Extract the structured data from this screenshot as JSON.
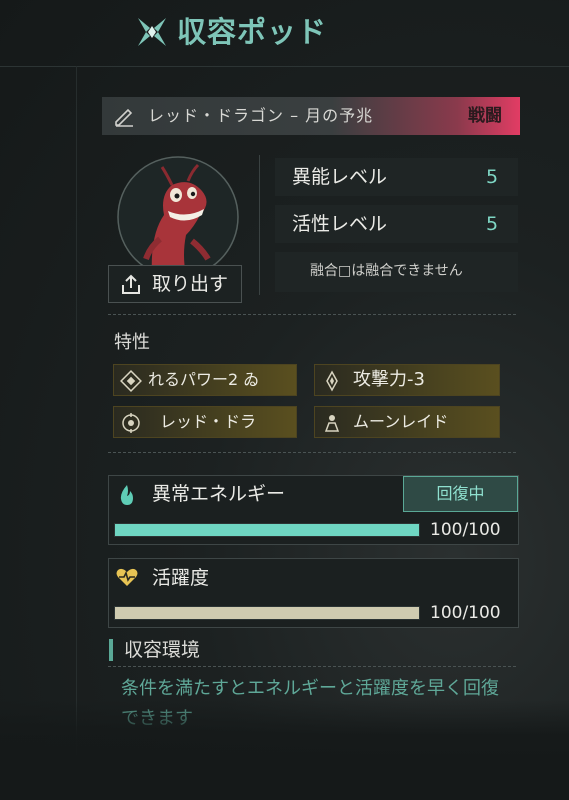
{
  "header": {
    "title": "収容ポッド",
    "icon": "x-emblem-icon"
  },
  "creature": {
    "name": "レッド・ドラゴン – 月の予兆",
    "tag": "戦闘",
    "extract_label": "取り出す"
  },
  "stats": [
    {
      "label": "異能レベル",
      "value": "5"
    },
    {
      "label": "活性レベル",
      "value": "5"
    }
  ],
  "fusion_note": "融合□は融合できません",
  "traits": {
    "title": "特性",
    "items": [
      {
        "icon": "diamond-icon",
        "label": "れるパワー2 ゐ"
      },
      {
        "icon": "crystal-icon",
        "label": "攻撃力-3"
      },
      {
        "icon": "target-icon",
        "label": "レッド・ドラ"
      },
      {
        "icon": "figure-icon",
        "label": "ムーンレイド"
      }
    ]
  },
  "energy": {
    "label": "異常エネルギー",
    "status": "回復中",
    "value_text": "100/100",
    "fraction": 1.0,
    "color": "#6fd6c2"
  },
  "activity": {
    "label": "活躍度",
    "value_text": "100/100",
    "fraction": 1.0,
    "color": "#cfcbb0"
  },
  "environment": {
    "title": "収容環境",
    "description": "条件を満たすとエネルギーと活躍度を早く回復できます"
  },
  "colors": {
    "accent": "#7ec5b8",
    "combat_tag": "#e23c64",
    "trait_gold": "#5a4f1f"
  }
}
